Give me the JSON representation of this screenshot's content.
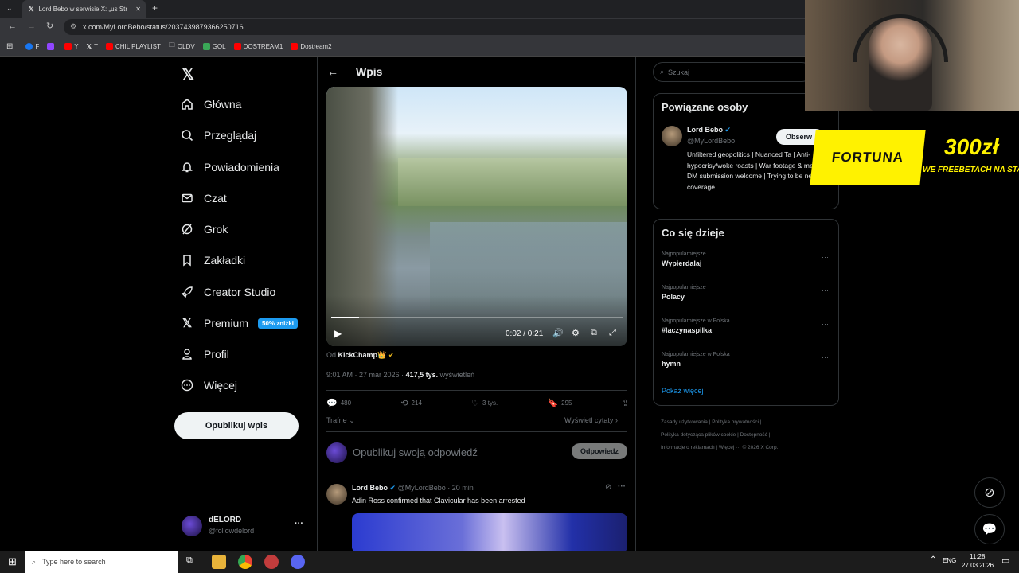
{
  "browser": {
    "tab_title": "Lord Bebo w serwisie X: „us Str",
    "url": "x.com/MyLordBebo/status/2037439879366250716",
    "bookmarks": [
      {
        "label": "F",
        "color": "#1877f2"
      },
      {
        "label": "",
        "color": "#9146ff"
      },
      {
        "label": "Y",
        "color": "#ff0000"
      },
      {
        "label": "T",
        "color": "#000000"
      },
      {
        "label": "CHIL PLAYLIST",
        "color": "#ff0000"
      },
      {
        "label": "OLDV",
        "color": "#888888"
      },
      {
        "label": "GOL",
        "color": "#3aa757"
      },
      {
        "label": "DOSTREAM1",
        "color": "#ff0000"
      },
      {
        "label": "Dostream2",
        "color": "#ff0000"
      }
    ]
  },
  "nav": {
    "items": [
      {
        "label": "Główna",
        "icon": "home-icon"
      },
      {
        "label": "Przeglądaj",
        "icon": "search-icon"
      },
      {
        "label": "Powiadomienia",
        "icon": "bell-icon"
      },
      {
        "label": "Czat",
        "icon": "mail-icon"
      },
      {
        "label": "Grok",
        "icon": "grok-icon"
      },
      {
        "label": "Zakładki",
        "icon": "bookmark-icon"
      },
      {
        "label": "Creator Studio",
        "icon": "rocket-icon"
      },
      {
        "label": "Premium",
        "icon": "x-icon"
      },
      {
        "label": "Profil",
        "icon": "person-icon"
      },
      {
        "label": "Więcej",
        "icon": "more-circle-icon"
      }
    ],
    "premium_badge": "50% zniżki",
    "publish_label": "Opublikuj wpis",
    "account_name": "dELORD",
    "account_handle": "@followdelord"
  },
  "post": {
    "header_title": "Wpis",
    "video_time": "0:02 / 0:21",
    "video_progress": 0.095,
    "from_prefix": "Od",
    "from_source": "KickChamp👑",
    "timestamp": "9:01 AM · 27 mar 2026 ·",
    "views": "417,5 tys.",
    "views_label": "wyświetleń",
    "replies": "480",
    "reposts": "214",
    "likes": "3 tys.",
    "bookmarks": "295",
    "sort_label": "Trafne",
    "quotes_label": "Wyświetl cytaty",
    "reply_placeholder": "Opublikuj swoją odpowiedź",
    "reply_button": "Odpowiedz"
  },
  "next_post": {
    "author": "Lord Bebo",
    "handle": "@MyLordBebo",
    "time": "· 20 min",
    "text": "Adin Ross confirmed that Clavicular has been arrested"
  },
  "right": {
    "search_placeholder": "Szukaj",
    "related_title": "Powiązane osoby",
    "related_name": "Lord Bebo",
    "related_handle": "@MyLordBebo",
    "follow_label": "Obserw",
    "related_bio": "Unfiltered geopolitics | Nuanced Ta | Anti- hypocrisy/woke roasts | War footage & memes | DM submission welcome | Trying to be neutral in coverage",
    "trends_title": "Co się dzieje",
    "trends": [
      {
        "category": "Najpopularniejsze",
        "name": "Wypierdalaj"
      },
      {
        "category": "Najpopularniejsze",
        "name": "Polacy"
      },
      {
        "category": "Najpopularniejsze w Polska",
        "name": "#laczynaspilka"
      },
      {
        "category": "Najpopularniejsze w Polska",
        "name": "hymn"
      }
    ],
    "show_more": "Pokaż więcej",
    "footer_line1": "Zasady użytkowania | Polityka prywatności |",
    "footer_line2": "Polityka dotycząca plików cookie | Dostępność |",
    "footer_line3": "Informacje o reklamach | Więcej ··· © 2026 X Corp."
  },
  "overlay": {
    "brand": "FORTUNA",
    "amount": "300zł",
    "subtitle": "WE FREEBETACH NA STAR"
  },
  "taskbar": {
    "search_placeholder": "Type here to search",
    "lang": "ENG",
    "time": "11:28",
    "date": "27.03.2026"
  },
  "colors": {
    "accent": "#1d9bf0",
    "fortuna": "#fff200"
  }
}
